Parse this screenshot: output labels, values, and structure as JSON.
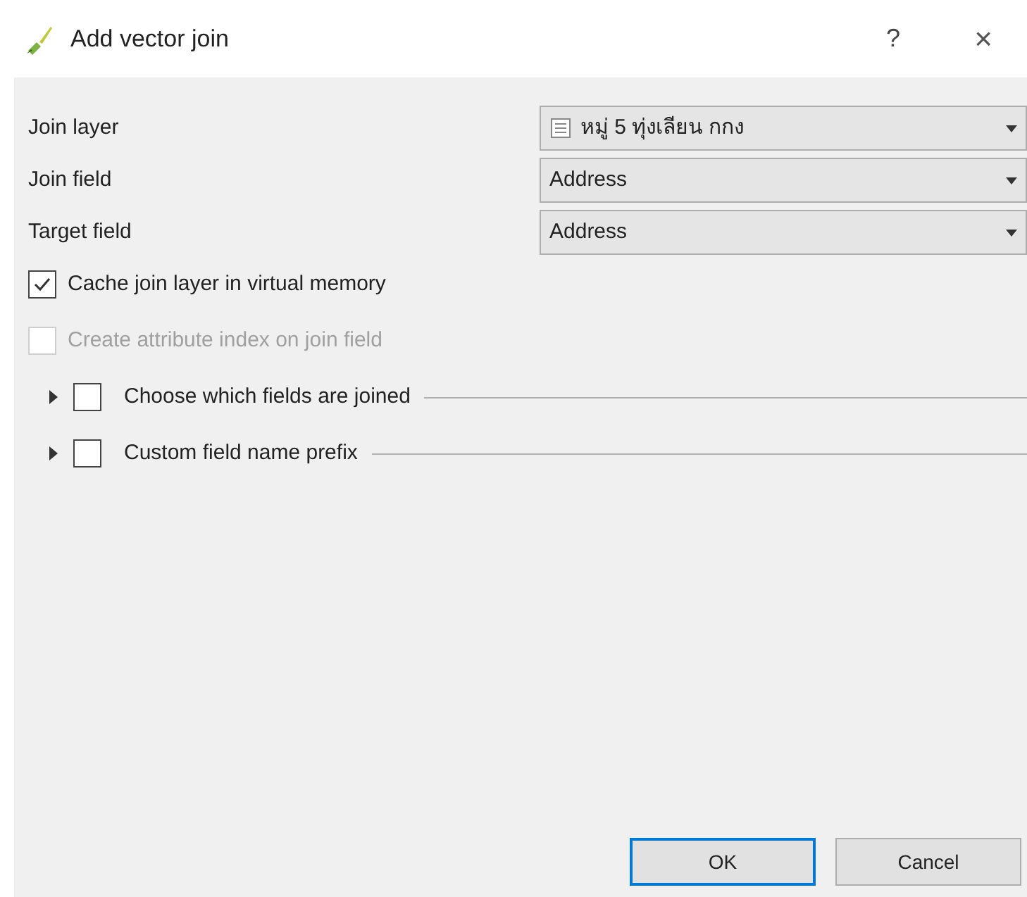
{
  "window": {
    "title": "Add vector join",
    "help": "?",
    "close": "×"
  },
  "fields": [
    {
      "label": "Join layer",
      "value": "หมู่ 5 ทุ่งเลียน กกง",
      "kind": "layer"
    },
    {
      "label": "Join field",
      "value": "Address",
      "kind": "field"
    },
    {
      "label": "Target field",
      "value": "Address",
      "kind": "field"
    }
  ],
  "options": [
    {
      "label": "Cache join layer in virtual memory",
      "checked": true,
      "disabled": false
    },
    {
      "label": "Create attribute index on join field",
      "checked": false,
      "disabled": true
    }
  ],
  "groups": [
    {
      "label": "Choose which fields are joined",
      "checked": false,
      "expanded": false
    },
    {
      "label": "Custom field name prefix",
      "checked": false,
      "expanded": false
    }
  ],
  "buttons": [
    {
      "label": "OK",
      "selected": true
    },
    {
      "label": "Cancel",
      "selected": false
    }
  ]
}
